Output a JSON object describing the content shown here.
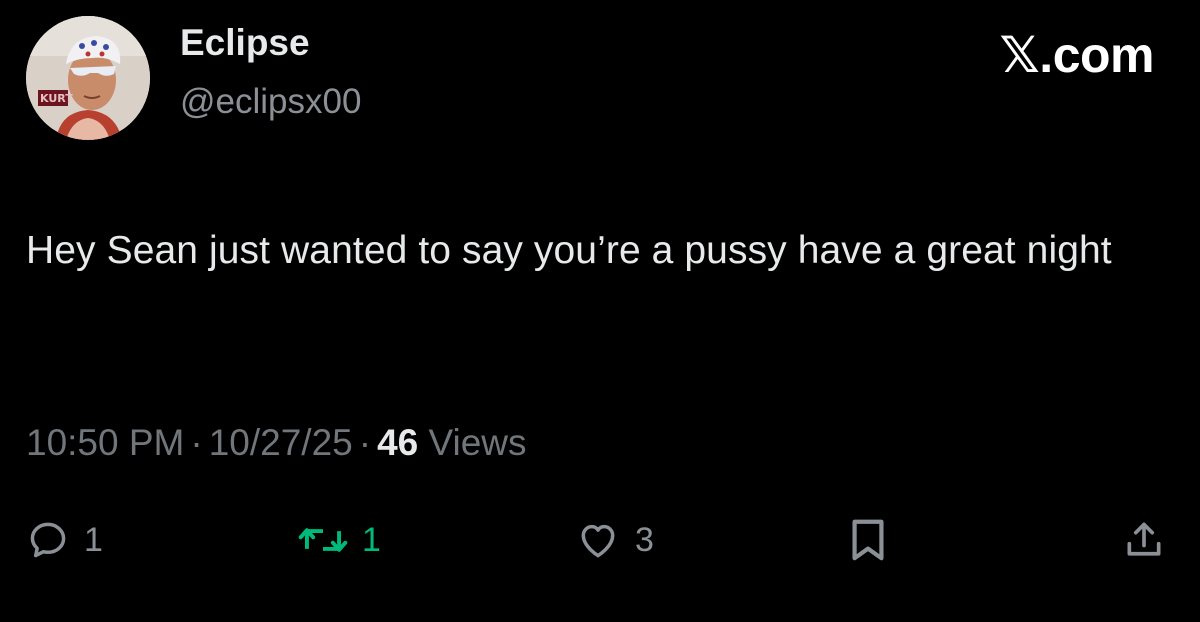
{
  "author": {
    "display_name": "Eclipse",
    "handle": "@eclipsx00",
    "avatar_caption": "KURT"
  },
  "brand": "𝕏.com",
  "tweet": {
    "text": "Hey Sean just wanted to say you’re a pussy have a great night"
  },
  "meta": {
    "time": "10:50 PM",
    "date": "10/27/25",
    "separator": "·",
    "views_count": "46",
    "views_label": "Views"
  },
  "actions": {
    "reply": {
      "icon": "reply-icon",
      "count": "1"
    },
    "retweet": {
      "icon": "retweet-icon",
      "count": "1",
      "active_color": "#00ba7c"
    },
    "like": {
      "icon": "heart-icon",
      "count": "3"
    },
    "bookmark": {
      "icon": "bookmark-icon"
    },
    "share": {
      "icon": "share-icon"
    }
  }
}
